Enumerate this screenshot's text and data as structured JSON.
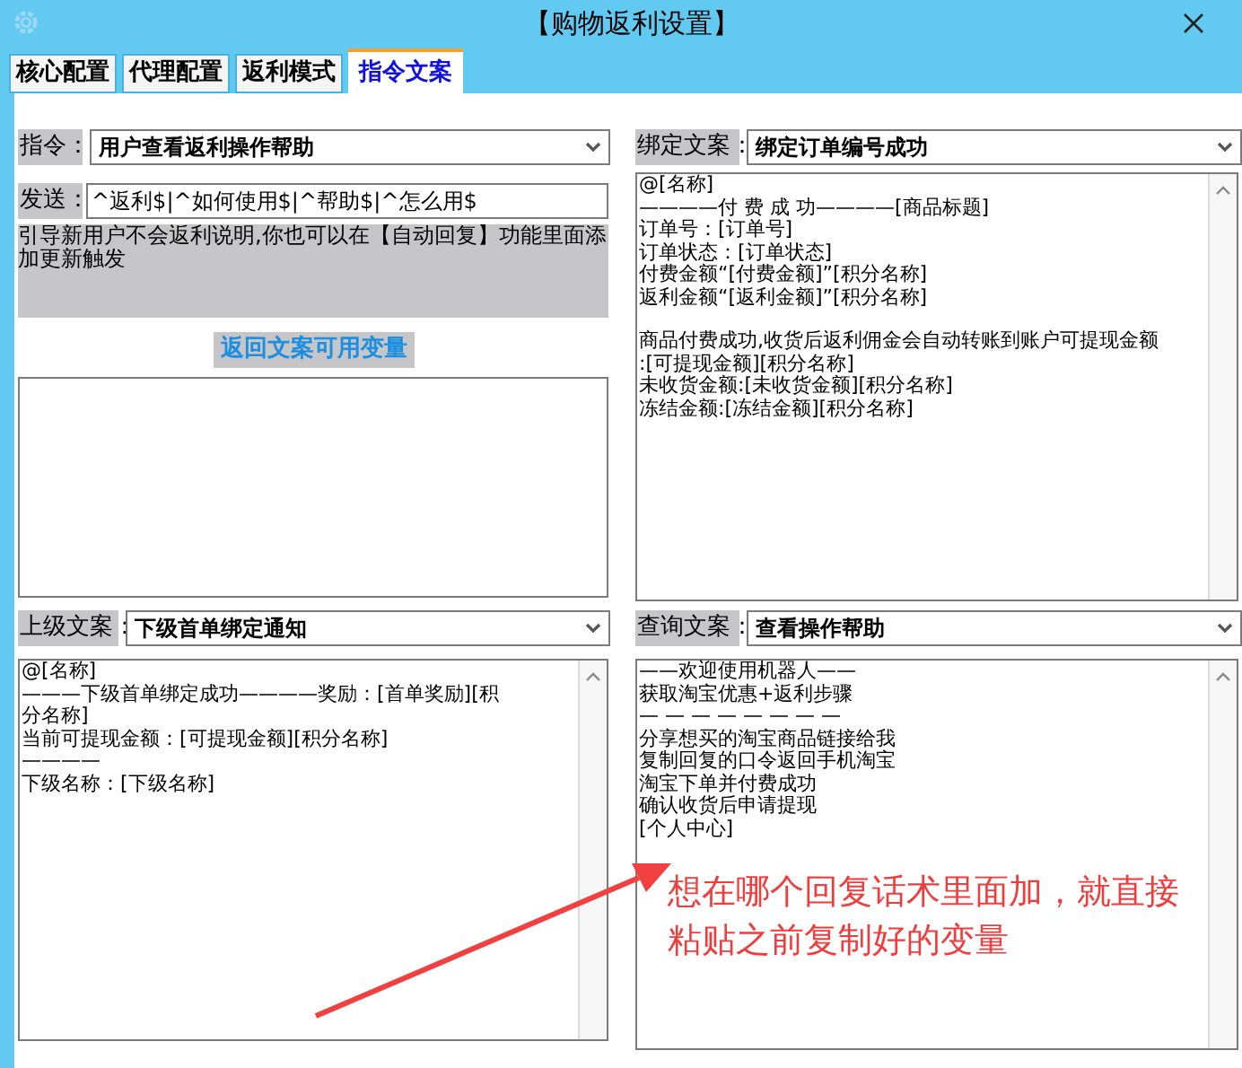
{
  "window": {
    "title": "【购物返利设置】"
  },
  "tabs": [
    {
      "label": "核心配置",
      "selected": false
    },
    {
      "label": "代理配置",
      "selected": false
    },
    {
      "label": "返利模式",
      "selected": false
    },
    {
      "label": "指令文案",
      "selected": true
    }
  ],
  "command": {
    "label": "指令：",
    "value": "用户查看返利操作帮助"
  },
  "send": {
    "label": "发送：",
    "value": "^返利$|^如何使用$|^帮助$|^怎么用$"
  },
  "note": "引导新用户不会返利说明,你也可以在【自动回复】功能里面添加更新触发",
  "variables_button": "返回文案可用变量",
  "bind": {
    "label": "绑定文案：",
    "value": "绑定订单编号成功",
    "paragraphs": [
      [
        "@[名称]",
        "————付 费 成 功————[商品标题]",
        "订单号：[订单号]",
        "订单状态：[订单状态]",
        "付费金额“[付费金额]”[积分名称]",
        "返利金额“[返利金额]”[积分名称]"
      ],
      [
        "商品付费成功,收货后返利佣金会自动转账到账户可提现金额",
        ":[可提现金额][积分名称]",
        "未收货金额:[未收货金额][积分名称]",
        "冻结金额:[冻结金额][积分名称]"
      ]
    ]
  },
  "parent": {
    "label": "上级文案：",
    "value": "下级首单绑定通知",
    "paragraphs": [
      [
        "@[名称]",
        "———下级首单绑定成功————奖励：[首单奖励][积",
        "分名称]",
        "当前可提现金额：[可提现金额][积分名称]",
        "————",
        "下级名称：[下级名称]"
      ]
    ]
  },
  "query": {
    "label": "查询文案：",
    "value": "查看操作帮助",
    "paragraphs": [
      [
        "——欢迎使用机器人——",
        "获取淘宝优惠+返利步骤",
        "— — — — — — — —",
        "分享想买的淘宝商品链接给我",
        "复制回复的口令返回手机淘宝",
        "淘宝下单并付费成功",
        "确认收货后申请提现",
        "[个人中心]"
      ]
    ]
  },
  "annotation": {
    "text": "想在哪个回复话术里面加，就直接粘贴之前复制好的变量"
  }
}
